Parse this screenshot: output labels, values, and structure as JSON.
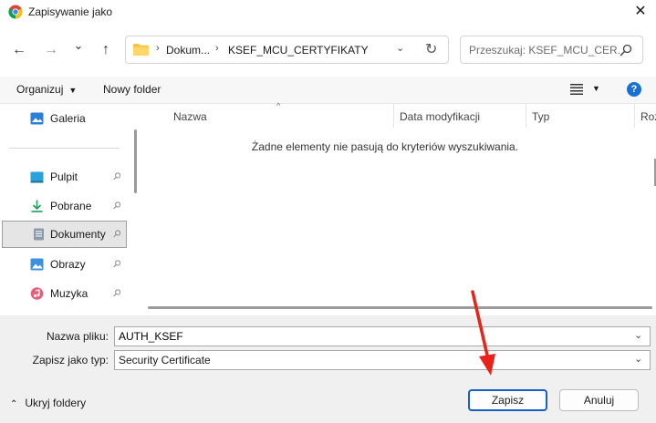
{
  "window": {
    "title": "Zapisywanie jako",
    "close_glyph": "✕"
  },
  "nav": {
    "back_glyph": "←",
    "forward_glyph": "→",
    "recent_glyph": "⌄",
    "up_glyph": "↑"
  },
  "address": {
    "sep_glyph": "›",
    "crumb_1": "Dokum...",
    "crumb_2": "KSEF_MCU_CERTYFIKATY",
    "chevron_glyph": "⌄",
    "refresh_glyph": "↻"
  },
  "search": {
    "placeholder": "Przeszukaj: KSEF_MCU_CER..."
  },
  "toolbar": {
    "organize_label": "Organizuj",
    "organize_caret": "▼",
    "new_folder_label": "Nowy folder",
    "view_caret": "▼",
    "help_glyph": "?"
  },
  "sidebar": {
    "items": [
      {
        "label": "Galeria",
        "icon": "gallery-icon"
      },
      {
        "label": "Pulpit",
        "icon": "desktop-icon",
        "pinned": true
      },
      {
        "label": "Pobrane",
        "icon": "download-icon",
        "pinned": true
      },
      {
        "label": "Dokumenty",
        "icon": "documents-icon",
        "pinned": true,
        "selected": true
      },
      {
        "label": "Obrazy",
        "icon": "pictures-icon",
        "pinned": true
      },
      {
        "label": "Muzyka",
        "icon": "music-icon",
        "pinned": true
      }
    ],
    "pin_glyph": "📌"
  },
  "file_list": {
    "columns": [
      "Nazwa",
      "Data modyfikacji",
      "Typ",
      "Roz"
    ],
    "sort_glyph": "^",
    "empty_message": "Żadne elementy nie pasują do kryteriów wyszukiwania."
  },
  "form": {
    "filename_label": "Nazwa pliku:",
    "filename_value": "AUTH_KSEF",
    "filetype_label": "Zapisz jako typ:",
    "filetype_value": "Security Certificate",
    "caret_glyph": "⌄"
  },
  "footer": {
    "hide_folders_glyph": "⌃",
    "hide_folders_label": "Ukryj foldery",
    "save_label": "Zapisz",
    "cancel_label": "Anuluj"
  },
  "colors": {
    "accent": "#1660c5",
    "annotation_arrow": "#e8231a"
  }
}
